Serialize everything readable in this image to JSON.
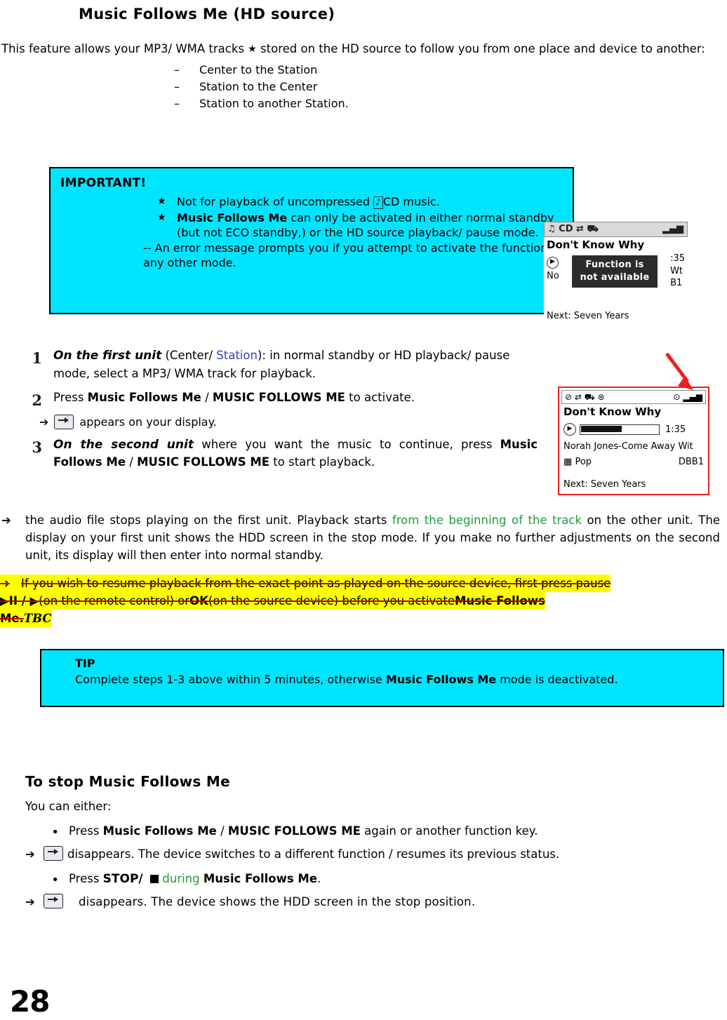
{
  "title": "Music Follows Me (HD source)",
  "intro": {
    "text_before_star": "This feature allows your MP3/ WMA tracks ",
    "star_glyph": "★",
    "text_after_star": " stored on the HD source to follow you from one place and device to another:",
    "dash": "–",
    "items": [
      "Center to the Station",
      "Station to the Center",
      "Station to another Station."
    ]
  },
  "important": {
    "header": "IMPORTANT!",
    "bullet_glyph": "★",
    "item1_pre": "Not for playback of uncompressed ",
    "item1_icon": "♪",
    "item1_post": "CD music.",
    "item2_bold": "Music Follows Me",
    "item2_rest": " can only be activated in either normal standby (but not ECO standby,) or the HD source playback/ pause mode.",
    "note": "-- An error message prompts you if you attempt to activate the function in any other mode."
  },
  "lcd_top": {
    "statusbar_left": "♫ CD ⇄ ⛟",
    "signal_icon": "▂▄▆",
    "song": "Don't Know Why",
    "play_icon": "▶",
    "left_label": "No",
    "popup_line1": "Function is",
    "popup_line2": "not available",
    "right_line1": ":35",
    "right_line2": "Wt",
    "right_line3": "B1",
    "next": "Next: Seven Years"
  },
  "lcd_bottom": {
    "statusbar_left": "⊘ ⇄ ⛟ ⊛",
    "statusbar_right": "⊙ ▂▄▆",
    "song": "Don't Know Why",
    "play_icon": "▶",
    "time": "1:35",
    "artist": "Norah Jones-Come Away Wit",
    "genre_icon": "▦",
    "genre": "Pop",
    "preset": "DBB1",
    "next": "Next: Seven Years"
  },
  "steps": [
    {
      "num": "1",
      "italic_lead": "On the first unit",
      "rest_a": " (Center/ ",
      "blue_word": "Station",
      "rest_b": "): in normal standby or HD playback/ pause mode, select a MP3/ WMA track for playback."
    },
    {
      "num": "2",
      "pre": " Press ",
      "bold1": "Music Follows Me",
      "mid": " / ",
      "bold2": "MUSIC FOLLOWS ME",
      "post": " to activate.",
      "sub_arrow": "➔",
      "sub_text": " appears on your display.",
      "sub_icon_name": "music-follows-me-badge"
    },
    {
      "num": "3",
      "italic_lead": "On the second unit",
      "rest_a": " where you want the music to continue, press ",
      "bold1": "Music Follows Me",
      "mid": " / ",
      "bold2": "MUSIC FOLLOWS ME",
      "post": " to start playback."
    }
  ],
  "paragraph1": {
    "arrow": "➔",
    "part1": "the audio file stops playing on the first unit. Playback starts ",
    "green": "from the beginning of the track",
    "part2": " on the other unit. The display on your first unit shows the HDD screen in the stop mode. If you make no further adjustments on the second unit, its display will then enter into normal standby."
  },
  "struck_paragraph": {
    "arrow": "➔",
    "line1": "If you wish to resume playback from the exact point as played on the source device, first press pause",
    "line2_icons": "▶II / ▶",
    "line2a": "(on the remote control) or ",
    "line2_bold": "OK",
    "line2b": " (on the source device) before you activate ",
    "line2_bold2": "Music Follows",
    "line3": "Me.",
    "tbc": "TBC"
  },
  "tip": {
    "header": "TIP",
    "line1_pre": "Complete steps 1-3 above within 5 minutes, otherwise ",
    "bold": "Music Follows Me",
    "line1_post": " mode is deactivated."
  },
  "stop_section": {
    "title": "To stop Music Follows Me",
    "intro": "You can either:",
    "bullet_glyph": "•",
    "arrow_glyph": "➔",
    "item1": {
      "pre": "Press ",
      "bold1": "Music Follows Me",
      "mid": " / ",
      "bold2": "MUSIC FOLLOWS ME",
      "post": " again or another function key."
    },
    "result1": " disappears. The device switches to a different function / resumes its previous status.",
    "item2": {
      "pre": "Press ",
      "bold1": "STOP/",
      "square": "■",
      "during": " during ",
      "bold2": "Music Follows Me",
      "post": "."
    },
    "result2": "disappears.  The  device  shows  the  HDD  screen  in  the  stop  position."
  },
  "page_number": "28",
  "colors": {
    "cyan_box": "#00e5ff",
    "highlight": "#ffff00",
    "strike": "#c00000",
    "green_text": "#1f9e3a",
    "blue_text": "#2b3fd0",
    "lcd_border_red": "#e8201e"
  }
}
